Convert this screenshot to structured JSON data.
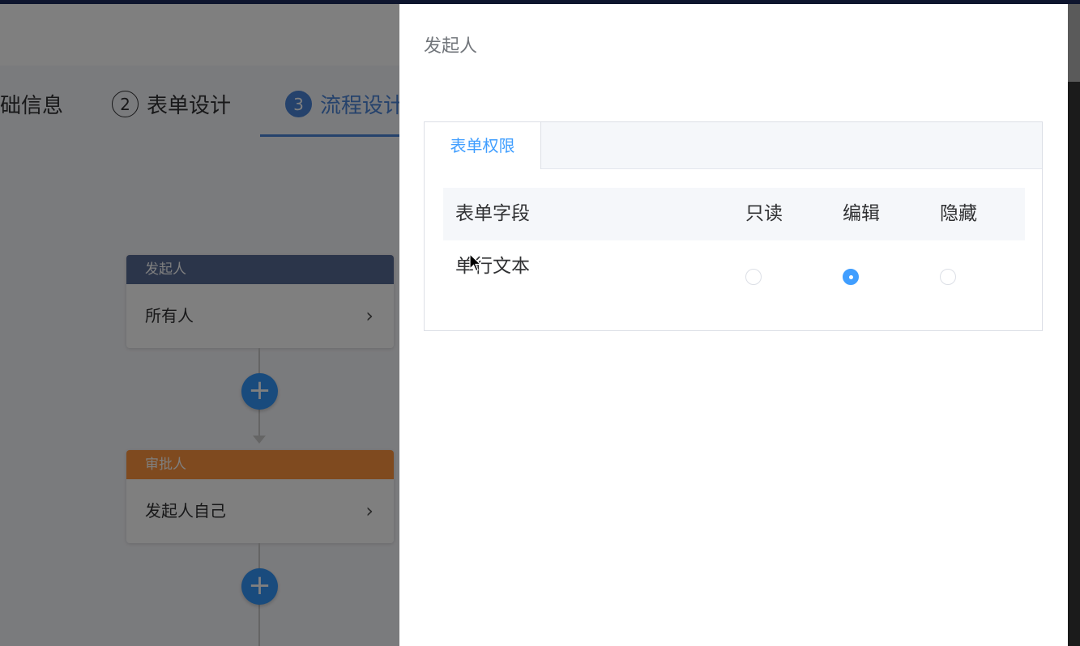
{
  "background": {
    "steps": [
      {
        "number": "",
        "label": "础信息",
        "active": false
      },
      {
        "number": "2",
        "label": "表单设计",
        "active": false
      },
      {
        "number": "3",
        "label": "流程设计",
        "active": true
      }
    ],
    "nodes": [
      {
        "header": "发起人",
        "body": "所有人"
      },
      {
        "header": "审批人",
        "body": "发起人自己"
      }
    ],
    "add_symbol": "+",
    "chevron": "›"
  },
  "drawer": {
    "title": "发起人",
    "tabs": [
      {
        "label": "表单权限",
        "active": true
      }
    ],
    "table": {
      "headers": {
        "field": "表单字段",
        "readonly": "只读",
        "edit": "编辑",
        "hidden": "隐藏"
      },
      "rows": [
        {
          "field": "单行文本",
          "selected": "edit"
        }
      ]
    }
  },
  "colors": {
    "accent": "#409eff",
    "step_active": "#4a84d9",
    "node_start": "#576a95",
    "node_approve": "#ff943e",
    "add_button": "#3296fa"
  }
}
